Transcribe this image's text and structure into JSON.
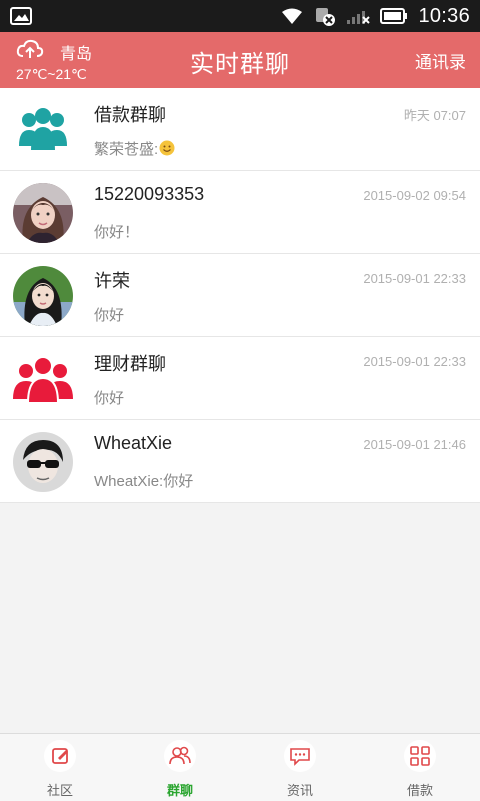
{
  "status_bar": {
    "time": "10:36",
    "icons": [
      "image-icon",
      "wifi-icon",
      "cellular-signal-icon",
      "battery-icon"
    ]
  },
  "header": {
    "city": "青岛",
    "temperature": "27℃~21℃",
    "title": "实时群聊",
    "right_action": "通讯录",
    "color": "#e46a6a"
  },
  "chats": [
    {
      "name": "借款群聊",
      "time": "昨天 07:07",
      "message": "繁荣苍盛:",
      "emoji": "smile",
      "avatar": "group-teal-icon"
    },
    {
      "name": "15220093353",
      "time": "2015-09-02 09:54",
      "message": "你好！",
      "avatar": "girl-photo-avatar"
    },
    {
      "name": "许荣",
      "time": "2015-09-01 22:33",
      "message": "你好",
      "avatar": "girl-photo-avatar-2"
    },
    {
      "name": "理财群聊",
      "time": "2015-09-01 22:33",
      "message": "你好",
      "avatar": "group-red-icon"
    },
    {
      "name": "WheatXie",
      "time": "2015-09-01 21:46",
      "message": "WheatXie:你好",
      "avatar": "man-photo-avatar"
    }
  ],
  "bottom_tabs": [
    {
      "label": "社区",
      "icon": "edit-icon",
      "active": false
    },
    {
      "label": "群聊",
      "icon": "group-chat-icon",
      "active": true
    },
    {
      "label": "资讯",
      "icon": "message-icon",
      "active": false
    },
    {
      "label": "借款",
      "icon": "grid-icon",
      "active": false
    }
  ],
  "colors": {
    "active_tab": "#2aa52f",
    "icon_red": "#e0484a",
    "teal": "#1fa3a3",
    "group_red": "#e81b3b"
  }
}
